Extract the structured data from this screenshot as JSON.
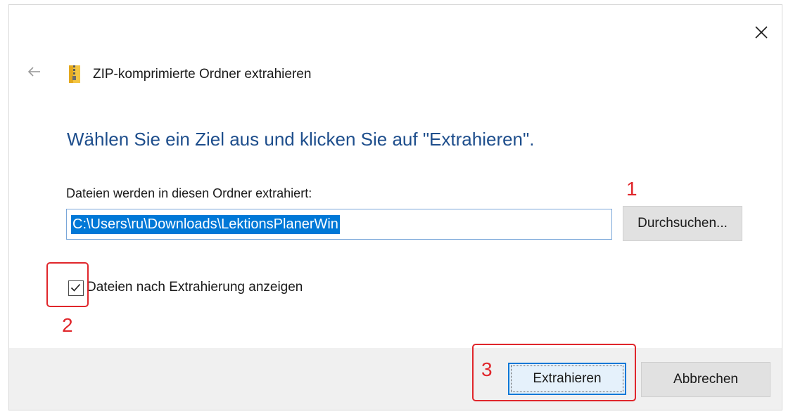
{
  "window": {
    "title": "ZIP-komprimierte Ordner extrahieren",
    "icons": {
      "close": "close-icon",
      "back": "back-arrow-icon",
      "zip_folder": "zip-folder-icon"
    }
  },
  "main": {
    "instruction": "Wählen Sie ein Ziel aus und klicken Sie auf \"Extrahieren\".",
    "destination_label": "Dateien werden in diesen Ordner extrahiert:",
    "destination_path": "C:\\Users\\ru\\Downloads\\LektionsPlanerWin",
    "browse_label": "Durchsuchen...",
    "show_files_checkbox": {
      "label": "Dateien nach Extrahierung anzeigen",
      "checked": true
    }
  },
  "footer": {
    "extract_label": "Extrahieren",
    "cancel_label": "Abbrechen"
  },
  "annotations": {
    "one": "1",
    "two": "2",
    "three": "3"
  },
  "colors": {
    "instruction_text": "#1e4e8c",
    "selection": "#0078d7",
    "annotation": "#e0262b",
    "footer_bg": "#f0f0f0"
  }
}
